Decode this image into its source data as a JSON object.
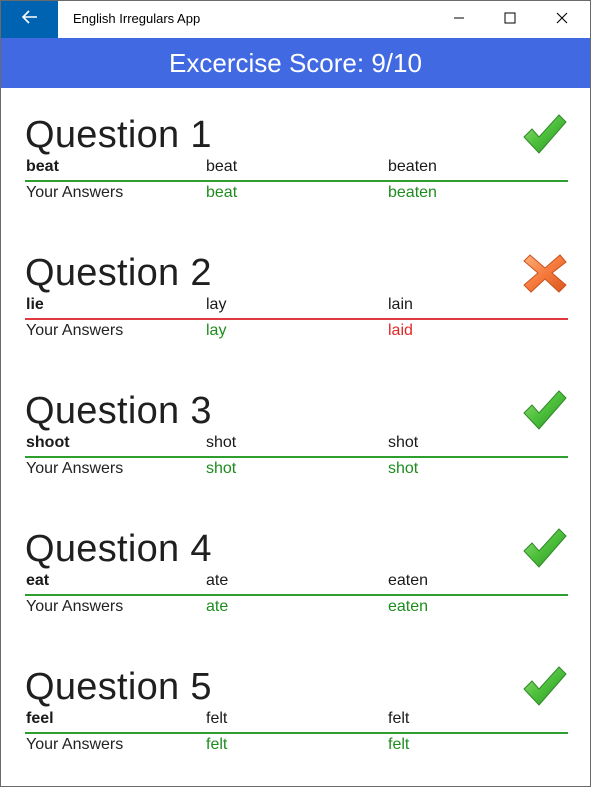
{
  "app": {
    "title": "English Irregulars App",
    "accent": "#0063b1",
    "header_color": "#4169e1"
  },
  "header": {
    "score_text": "Excercise Score: 9/10"
  },
  "icons": {
    "back": "arrow-left-icon",
    "minimize": "minimize-icon",
    "maximize": "maximize-icon",
    "close": "close-icon",
    "correct": "checkmark-icon",
    "incorrect": "cross-icon"
  },
  "colors": {
    "correct": "#2e9e2e",
    "incorrect": "#e0393f"
  },
  "answers_label": "Your Answers",
  "questions": [
    {
      "title": "Question 1",
      "status": "correct",
      "verb": "beat",
      "past": "beat",
      "participle": "beaten",
      "answers": [
        {
          "text": "beat",
          "correct": true
        },
        {
          "text": "beaten",
          "correct": true
        }
      ]
    },
    {
      "title": "Question 2",
      "status": "incorrect",
      "verb": "lie",
      "past": "lay",
      "participle": "lain",
      "answers": [
        {
          "text": "lay",
          "correct": true
        },
        {
          "text": "laid",
          "correct": false
        }
      ]
    },
    {
      "title": "Question 3",
      "status": "correct",
      "verb": "shoot",
      "past": "shot",
      "participle": "shot",
      "answers": [
        {
          "text": "shot",
          "correct": true
        },
        {
          "text": "shot",
          "correct": true
        }
      ]
    },
    {
      "title": "Question 4",
      "status": "correct",
      "verb": "eat",
      "past": "ate",
      "participle": "eaten",
      "answers": [
        {
          "text": "ate",
          "correct": true
        },
        {
          "text": "eaten",
          "correct": true
        }
      ]
    },
    {
      "title": "Question 5",
      "status": "correct",
      "verb": "feel",
      "past": "felt",
      "participle": "felt",
      "answers": [
        {
          "text": "felt",
          "correct": true
        },
        {
          "text": "felt",
          "correct": true
        }
      ]
    }
  ]
}
